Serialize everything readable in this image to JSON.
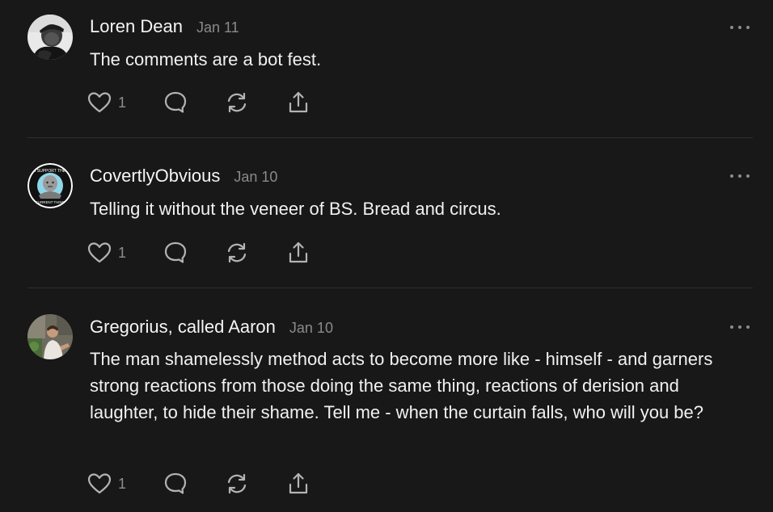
{
  "comments": [
    {
      "author": "Loren Dean",
      "date": "Jan 11",
      "text": "The comments are a bot fest.",
      "like_count": "1"
    },
    {
      "author": "CovertlyObvious",
      "date": "Jan 10",
      "text": "Telling it without the veneer of BS. Bread and circus.",
      "like_count": "1",
      "avatar_badge_top": "I SUPPORT THE",
      "avatar_badge_bottom": "CURRENT THING"
    },
    {
      "author": "Gregorius, called Aaron",
      "date": "Jan 10",
      "text": "The man shamelessly method acts to become more like - himself - and garners strong reactions from those doing the same thing, reactions of derision and laughter, to hide their shame. Tell me - when the curtain falls, who will you be?",
      "like_count": "1"
    }
  ],
  "icons": [
    "heart-icon",
    "comment-icon",
    "restack-icon",
    "share-icon",
    "more-options-icon"
  ],
  "colors": {
    "background": "#181818",
    "text": "#f1f1f1",
    "muted": "#8a8a8e",
    "divider": "#2f2f2f"
  }
}
